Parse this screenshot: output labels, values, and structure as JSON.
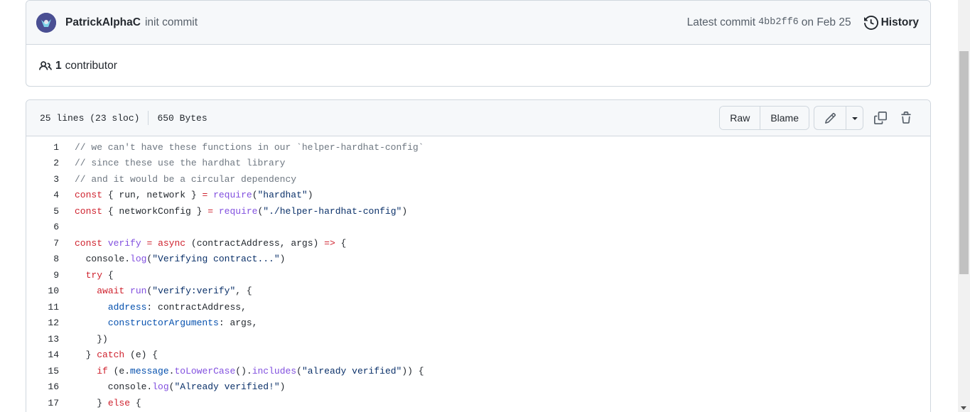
{
  "commit": {
    "author": "PatrickAlphaC",
    "message": "init commit",
    "latest_label": "Latest commit",
    "sha": "4bb2ff6",
    "date": "on Feb 25",
    "history_label": "History"
  },
  "contributors": {
    "count": "1",
    "label": "contributor"
  },
  "file": {
    "lines_info": "25 lines (23 sloc)",
    "size": "650 Bytes",
    "raw_label": "Raw",
    "blame_label": "Blame"
  },
  "icons": {
    "avatar": "avatar-image",
    "history": "history-icon",
    "contributors": "people-icon",
    "edit": "pencil-icon",
    "dropdown": "triangle-down-icon",
    "copy": "copy-icon",
    "delete": "trash-icon"
  },
  "code_lines": [
    [
      [
        "c",
        "// we can't have these functions in our `helper-hardhat-config`"
      ]
    ],
    [
      [
        "c",
        "// since these use the hardhat library"
      ]
    ],
    [
      [
        "c",
        "// and it would be a circular dependency"
      ]
    ],
    [
      [
        "k",
        "const"
      ],
      [
        "t",
        " { run, network } "
      ],
      [
        "k",
        "="
      ],
      [
        "t",
        " "
      ],
      [
        "f",
        "require"
      ],
      [
        "t",
        "("
      ],
      [
        "s",
        "\"hardhat\""
      ],
      [
        "t",
        ")"
      ]
    ],
    [
      [
        "k",
        "const"
      ],
      [
        "t",
        " { networkConfig } "
      ],
      [
        "k",
        "="
      ],
      [
        "t",
        " "
      ],
      [
        "f",
        "require"
      ],
      [
        "t",
        "("
      ],
      [
        "s",
        "\"./helper-hardhat-config\""
      ],
      [
        "t",
        ")"
      ]
    ],
    [],
    [
      [
        "k",
        "const"
      ],
      [
        "t",
        " "
      ],
      [
        "f",
        "verify"
      ],
      [
        "t",
        " "
      ],
      [
        "k",
        "="
      ],
      [
        "t",
        " "
      ],
      [
        "k",
        "async"
      ],
      [
        "t",
        " (contractAddress, args) "
      ],
      [
        "k",
        "=>"
      ],
      [
        "t",
        " {"
      ]
    ],
    [
      [
        "t",
        "  console."
      ],
      [
        "f",
        "log"
      ],
      [
        "t",
        "("
      ],
      [
        "s",
        "\"Verifying contract...\""
      ],
      [
        "t",
        ")"
      ]
    ],
    [
      [
        "t",
        "  "
      ],
      [
        "k",
        "try"
      ],
      [
        "t",
        " {"
      ]
    ],
    [
      [
        "t",
        "    "
      ],
      [
        "k",
        "await"
      ],
      [
        "t",
        " "
      ],
      [
        "f",
        "run"
      ],
      [
        "t",
        "("
      ],
      [
        "s",
        "\"verify:verify\""
      ],
      [
        "t",
        ", {"
      ]
    ],
    [
      [
        "t",
        "      "
      ],
      [
        "p",
        "address"
      ],
      [
        "t",
        ": contractAddress,"
      ]
    ],
    [
      [
        "t",
        "      "
      ],
      [
        "p",
        "constructorArguments"
      ],
      [
        "t",
        ": args,"
      ]
    ],
    [
      [
        "t",
        "    })"
      ]
    ],
    [
      [
        "t",
        "  } "
      ],
      [
        "k",
        "catch"
      ],
      [
        "t",
        " (e) {"
      ]
    ],
    [
      [
        "t",
        "    "
      ],
      [
        "k",
        "if"
      ],
      [
        "t",
        " (e."
      ],
      [
        "p",
        "message"
      ],
      [
        "t",
        "."
      ],
      [
        "f",
        "toLowerCase"
      ],
      [
        "t",
        "()."
      ],
      [
        "f",
        "includes"
      ],
      [
        "t",
        "("
      ],
      [
        "s",
        "\"already verified\""
      ],
      [
        "t",
        ")) {"
      ]
    ],
    [
      [
        "t",
        "      console."
      ],
      [
        "f",
        "log"
      ],
      [
        "t",
        "("
      ],
      [
        "s",
        "\"Already verified!\""
      ],
      [
        "t",
        ")"
      ]
    ],
    [
      [
        "t",
        "    } "
      ],
      [
        "k",
        "else"
      ],
      [
        "t",
        " {"
      ]
    ]
  ]
}
